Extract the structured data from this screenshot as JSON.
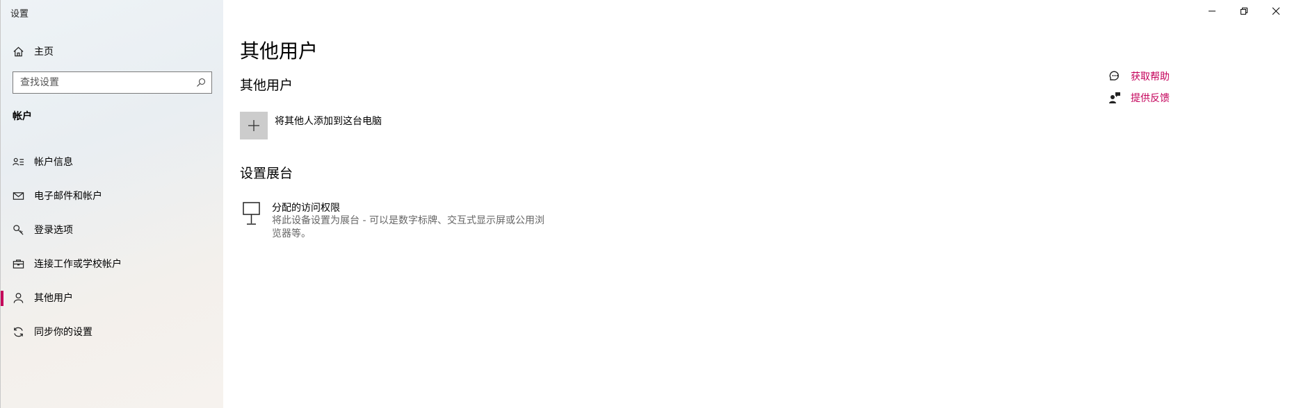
{
  "window": {
    "title": "设置",
    "controls": [
      "minimize-icon",
      "restore-icon",
      "close-icon"
    ]
  },
  "sidebar": {
    "home_label": "主页",
    "search_placeholder": "查找设置",
    "section_label": "帐户",
    "items": [
      {
        "label": "帐户信息",
        "icon": "person-card-icon",
        "active": false
      },
      {
        "label": "电子邮件和帐户",
        "icon": "mail-icon",
        "active": false
      },
      {
        "label": "登录选项",
        "icon": "key-icon",
        "active": false
      },
      {
        "label": "连接工作或学校帐户",
        "icon": "briefcase-icon",
        "active": false
      },
      {
        "label": "其他用户",
        "icon": "person-icon",
        "active": true
      },
      {
        "label": "同步你的设置",
        "icon": "sync-icon",
        "active": false
      }
    ]
  },
  "main": {
    "page_title": "其他用户",
    "other_users_heading": "其他用户",
    "add_user_label": "将其他人添加到这台电脑",
    "kiosk_heading": "设置展台",
    "kiosk_title": "分配的访问权限",
    "kiosk_description": "将此设备设置为展台 - 可以是数字标牌、交互式显示屏或公用浏览器等。"
  },
  "help": {
    "get_help": "获取帮助",
    "feedback": "提供反馈"
  },
  "colors": {
    "accent": "#c4005a",
    "tile": "#cccccc",
    "secondary_text": "#666666"
  }
}
